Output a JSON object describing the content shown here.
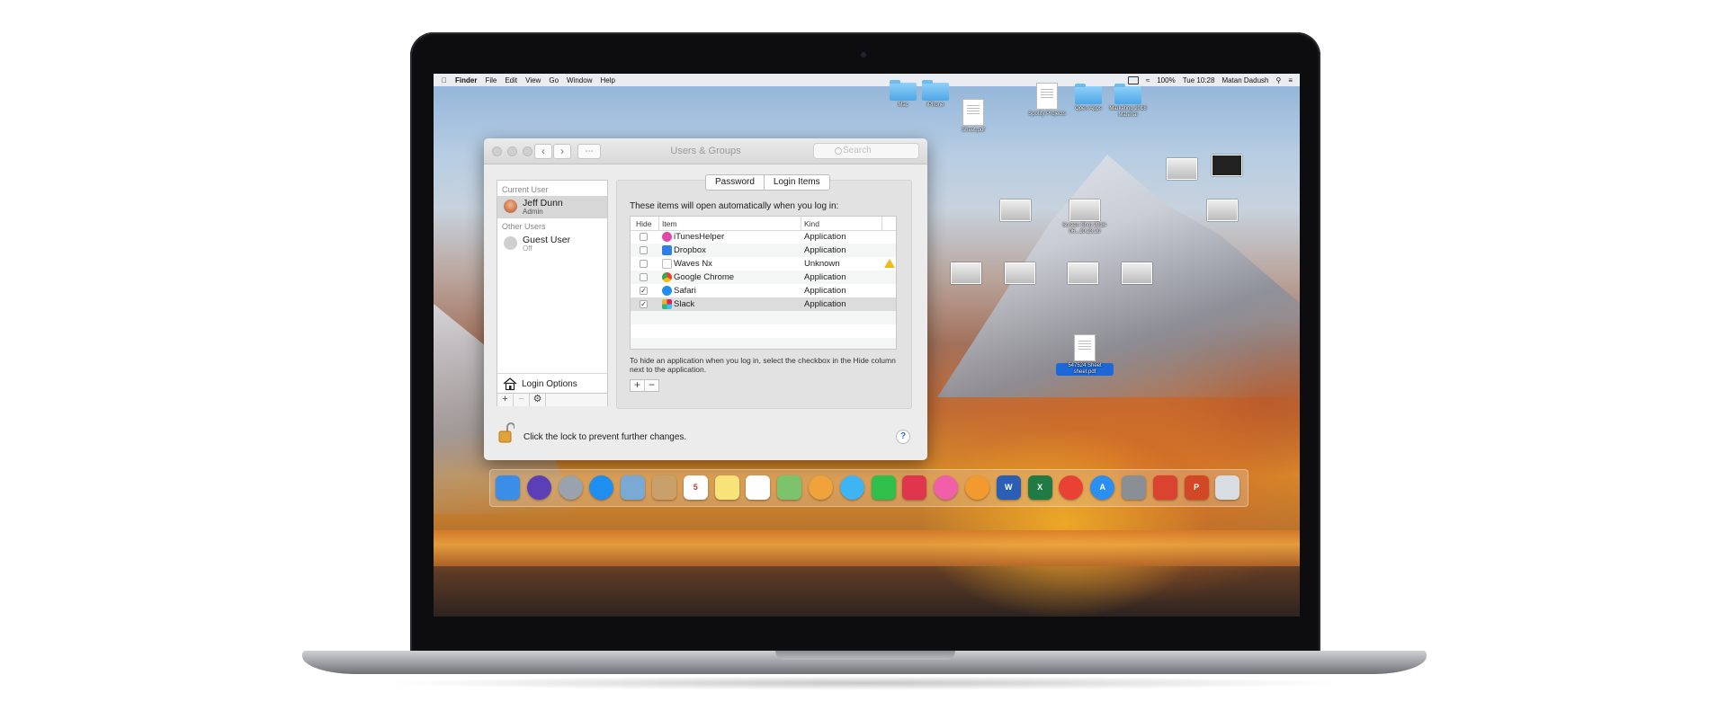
{
  "device": {
    "label": "MacBook Pro"
  },
  "menubar": {
    "app": "Finder",
    "items": [
      "File",
      "Edit",
      "View",
      "Go",
      "Window",
      "Help"
    ],
    "battery": "100%",
    "clock": "Tue 10:28",
    "user": "Matan Dadush"
  },
  "window": {
    "title": "Users & Groups",
    "search_placeholder": "Search",
    "sidebar": {
      "current_user_header": "Current User",
      "current_user": {
        "name": "Jeff Dunn",
        "role": "Admin"
      },
      "other_users_header": "Other Users",
      "other_users": [
        {
          "name": "Guest User",
          "status": "Off"
        }
      ],
      "login_options": "Login Options"
    },
    "tabs": [
      {
        "label": "Password",
        "active": false
      },
      {
        "label": "Login Items",
        "active": true
      }
    ],
    "login_items": {
      "intro": "These items will open automatically when you log in:",
      "columns": {
        "hide": "Hide",
        "item": "Item",
        "kind": "Kind"
      },
      "rows": [
        {
          "name": "iTunesHelper",
          "kind": "Application",
          "hide": false,
          "icon": "itunes-icon",
          "color": "#e04aa6"
        },
        {
          "name": "Dropbox",
          "kind": "Application",
          "hide": false,
          "icon": "dropbox-icon",
          "color": "#2f7ee6"
        },
        {
          "name": "Waves Nx",
          "kind": "Unknown",
          "hide": false,
          "icon": "document-icon",
          "color": "#ffffff",
          "warning": true
        },
        {
          "name": "Google Chrome",
          "kind": "Application",
          "hide": false,
          "icon": "chrome-icon",
          "color": "#e94235"
        },
        {
          "name": "Safari",
          "kind": "Application",
          "hide": true,
          "icon": "safari-icon",
          "color": "#1e8ef0"
        },
        {
          "name": "Slack",
          "kind": "Application",
          "hide": true,
          "icon": "slack-icon",
          "color": "#e01e5a",
          "selected": true
        }
      ],
      "hint": "To hide an application when you log in, select the checkbox in the Hide column next to the application."
    },
    "lock_message": "Click the lock to prevent further changes.",
    "help": "?"
  },
  "desktop_icons": [
    {
      "label": "Mac",
      "type": "folder"
    },
    {
      "label": "iPhone",
      "type": "folder"
    },
    {
      "label": "Sheet.pdf",
      "type": "doc"
    },
    {
      "label": "Spotify Projects",
      "type": "doc"
    },
    {
      "label": "Open Apps",
      "type": "folder"
    },
    {
      "label": "Marketing 2018 Material",
      "type": "folder"
    },
    {
      "label": "Screen Shot 2018-06...10.23.20",
      "type": "shot"
    },
    {
      "label": "547524 Sheet sheet.pdf",
      "type": "doc",
      "selected": true
    }
  ],
  "dock": {
    "apps": [
      {
        "name": "finder-icon",
        "color": "#3a8ee8"
      },
      {
        "name": "siri-icon",
        "color": "#5b3fb6"
      },
      {
        "name": "launchpad-icon",
        "color": "#9aa3ad"
      },
      {
        "name": "safari-icon",
        "color": "#1e8ef0"
      },
      {
        "name": "preview-icon",
        "color": "#7aa9d6"
      },
      {
        "name": "contacts-icon",
        "color": "#c9a06a"
      },
      {
        "name": "calendar-icon",
        "color": "#ffffff",
        "text": "5"
      },
      {
        "name": "notes-icon",
        "color": "#f8e27a"
      },
      {
        "name": "reminders-icon",
        "color": "#ffffff"
      },
      {
        "name": "maps-icon",
        "color": "#7cc36b"
      },
      {
        "name": "photos-icon",
        "color": "#f0a33a"
      },
      {
        "name": "messages-icon",
        "color": "#3fb4f5"
      },
      {
        "name": "facetime-icon",
        "color": "#2fbf4a"
      },
      {
        "name": "airmail-icon",
        "color": "#e0364d"
      },
      {
        "name": "itunes-icon",
        "color": "#f05fa8"
      },
      {
        "name": "ibooks-icon",
        "color": "#f29a2e"
      },
      {
        "name": "word-icon",
        "color": "#2b5eb5",
        "text": "W"
      },
      {
        "name": "excel-icon",
        "color": "#1f7a44",
        "text": "X"
      },
      {
        "name": "chrome-icon",
        "color": "#e94235"
      },
      {
        "name": "app-store-icon",
        "color": "#2a8ff0",
        "text": "A"
      },
      {
        "name": "system-preferences-icon",
        "color": "#8a8f96"
      },
      {
        "name": "remote-desktop-icon",
        "color": "#d9432f"
      },
      {
        "name": "powerpoint-icon",
        "color": "#d24726",
        "text": "P"
      },
      {
        "name": "trash-icon",
        "color": "#d8dde2"
      }
    ]
  }
}
